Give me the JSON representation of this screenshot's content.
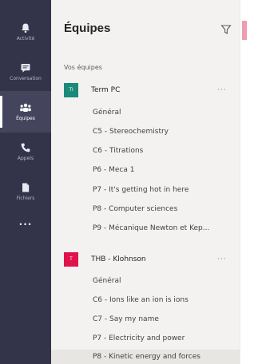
{
  "rail": {
    "items": [
      {
        "label": "Activité",
        "icon": "bell-icon"
      },
      {
        "label": "Conversation",
        "icon": "chat-icon"
      },
      {
        "label": "Équipes",
        "icon": "teams-icon",
        "active": true
      },
      {
        "label": "Appels",
        "icon": "phone-icon"
      },
      {
        "label": "Fichiers",
        "icon": "file-icon"
      },
      {
        "label": "...",
        "icon": "more-icon"
      }
    ]
  },
  "panel": {
    "title": "Équipes",
    "filter_icon": "filter-icon",
    "section_label": "Vos équipes",
    "teams": [
      {
        "avatar_text": "TI",
        "avatar_color": "#1b8a7a",
        "name": "Term PC",
        "more": "···",
        "channels": [
          "Général",
          "C5 - Stereochemistry",
          "C6 - Titrations",
          "P6 - Meca 1",
          "P7 - It's getting hot in here",
          "P8 - Computer sciences",
          "P9 - Mécanique Newton et Kep..."
        ]
      },
      {
        "avatar_text": "T",
        "avatar_color": "#e0124c",
        "name": "THB - Klohnson",
        "more": "···",
        "channels": [
          "Général",
          "C6 - Ions like an ion is ions",
          "C7 - Say my name",
          "P7 - Electricity and power",
          "P8 - Kinetic energy and forces"
        ],
        "selected_channel": 4
      }
    ]
  },
  "colors": {
    "rail_bg": "#33344a",
    "panel_bg": "#f3f2f1",
    "accent": "#6264a7"
  }
}
